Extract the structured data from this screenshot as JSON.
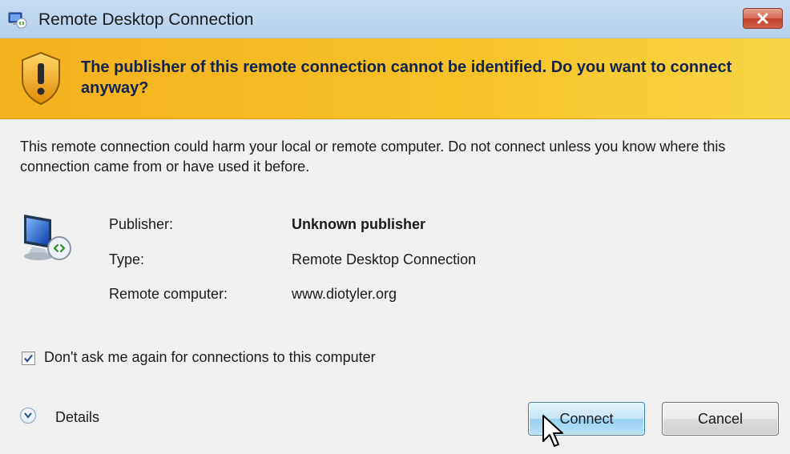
{
  "window": {
    "title": "Remote Desktop Connection",
    "icon": "remote-desktop-icon",
    "close_icon": "close-icon"
  },
  "banner": {
    "icon": "warning-shield-icon",
    "message": "The publisher of this remote connection cannot be identified. Do you want to connect anyway?"
  },
  "body": {
    "description": "This remote connection could harm your local or remote computer. Do not connect unless you know where this connection came from or have used it before.",
    "icon": "remote-computer-icon",
    "info": [
      {
        "label": "Publisher:",
        "value": "Unknown publisher"
      },
      {
        "label": "Type:",
        "value": "Remote Desktop Connection"
      },
      {
        "label": "Remote computer:",
        "value": "www.diotyler.org"
      }
    ],
    "dont_ask": {
      "label": "Don't ask me again for connections to this computer",
      "checked": true
    }
  },
  "footer": {
    "details_label": "Details",
    "details_icon": "chevron-down-icon",
    "connect_label": "Connect",
    "cancel_label": "Cancel"
  },
  "colors": {
    "banner": "#f7c227",
    "banner_text": "#11234d",
    "title_bar": "#c6dcf2",
    "close_button": "#c2402a",
    "connect_button_border": "#3c7fb1"
  }
}
